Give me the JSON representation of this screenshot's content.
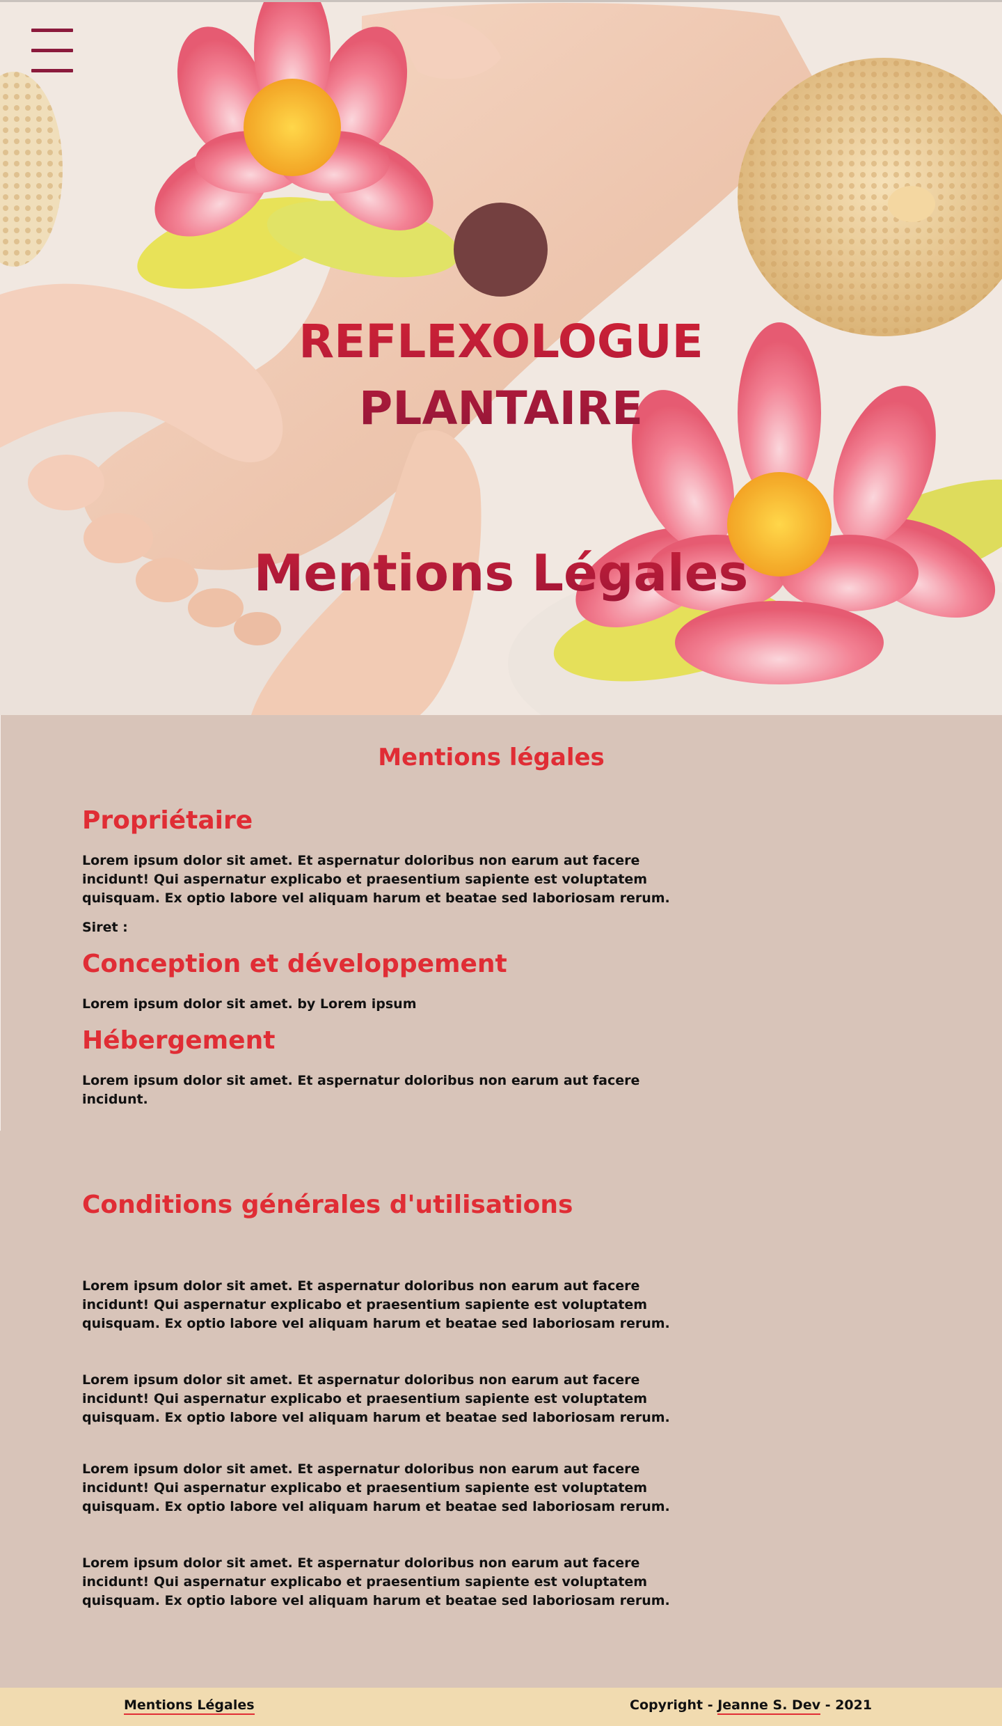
{
  "hero": {
    "site_title_line1": "REFLEXOLOGUE",
    "site_title_line2": "PLANTAIRE",
    "page_title": "Mentions Légales",
    "menu_icon": "hamburger-icon",
    "background_image": "lotus-flowers-foot-massage",
    "colors": {
      "title": "#c81e36",
      "logo_circle": "#744040",
      "menu": "#8b1a3c"
    }
  },
  "main": {
    "heading": "Mentions légales",
    "sections": [
      {
        "title": "Propriétaire",
        "paragraphs": [
          "Lorem ipsum dolor sit amet. Et aspernatur doloribus non earum aut facere incidunt! Qui aspernatur explicabo et praesentium sapiente est voluptatem quisquam. Ex optio labore vel aliquam harum et beatae sed laboriosam rerum.",
          "Siret :"
        ]
      },
      {
        "title": "Conception et développement",
        "paragraphs": [
          "Lorem ipsum dolor sit amet. by Lorem ipsum"
        ]
      },
      {
        "title": "Hébergement",
        "paragraphs": [
          "Lorem ipsum dolor sit amet. Et aspernatur doloribus non earum aut facere incidunt."
        ]
      }
    ],
    "conditions": {
      "title": "Conditions générales d'utilisations",
      "paragraphs": [
        "Lorem ipsum dolor sit amet. Et aspernatur doloribus non earum aut facere incidunt! Qui aspernatur explicabo et praesentium sapiente est voluptatem quisquam. Ex optio labore vel aliquam harum et beatae sed laboriosam rerum.",
        "Lorem ipsum dolor sit amet. Et aspernatur doloribus non earum aut facere incidunt! Qui aspernatur explicabo et praesentium sapiente est voluptatem quisquam. Ex optio labore vel aliquam harum et beatae sed laboriosam rerum.",
        "Lorem ipsum dolor sit amet. Et aspernatur doloribus non earum aut facere incidunt! Qui aspernatur explicabo et praesentium sapiente est voluptatem quisquam. Ex optio labore vel aliquam harum et beatae sed laboriosam rerum.",
        "Lorem ipsum dolor sit amet. Et aspernatur doloribus non earum aut facere incidunt! Qui aspernatur explicabo et praesentium sapiente est voluptatem quisquam. Ex optio labore vel aliquam harum et beatae sed laboriosam rerum."
      ]
    },
    "colors": {
      "heading": "#e02d35",
      "background": "#d8c4b9",
      "text": "#111111"
    }
  },
  "footer": {
    "legal_link": "Mentions Légales",
    "copyright_prefix": "Copyright - ",
    "author_link": "Jeanne S. Dev",
    "copyright_suffix": " - 2021",
    "colors": {
      "background": "#f1dbb0",
      "underline": "#e02d35"
    }
  }
}
